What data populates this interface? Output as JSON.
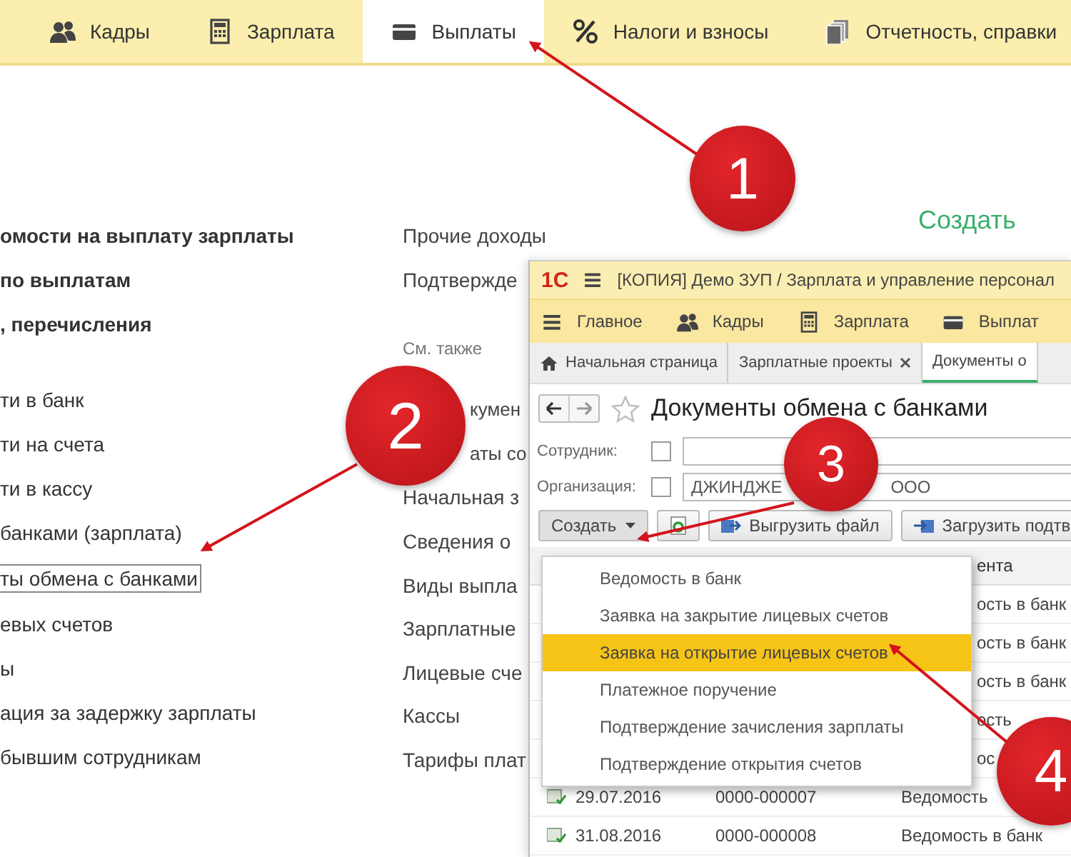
{
  "top_menu": [
    {
      "kind": "people",
      "label": "Кадры",
      "selected": false
    },
    {
      "kind": "calculator",
      "label": "Зарплата",
      "selected": false
    },
    {
      "kind": "card",
      "label": "Выплаты",
      "selected": true
    },
    {
      "kind": "percent",
      "label": "Налоги и взносы",
      "selected": false
    },
    {
      "kind": "documents",
      "label": "Отчетность, справки",
      "selected": false
    }
  ],
  "left_column": [
    {
      "text": "омости на выплату зарплаты",
      "kind": "heading",
      "focused": false
    },
    {
      "text": "по выплатам",
      "kind": "heading",
      "focused": false
    },
    {
      "text": ", перечисления",
      "kind": "heading",
      "focused": false
    },
    {
      "text": "ти в банк",
      "kind": "link",
      "focused": false
    },
    {
      "text": "ти на счета",
      "kind": "link",
      "focused": false
    },
    {
      "text": "ти в кассу",
      "kind": "link",
      "focused": false
    },
    {
      "text": "банками (зарплата)",
      "kind": "link",
      "focused": false
    },
    {
      "text": "ты обмена с банками",
      "kind": "link",
      "focused": true
    },
    {
      "text": "евых счетов",
      "kind": "link",
      "focused": false
    },
    {
      "text": "ы",
      "kind": "link",
      "focused": false
    },
    {
      "text": "ация за задержку зарплаты",
      "kind": "link",
      "focused": false
    },
    {
      "text": "бывшим сотрудникам",
      "kind": "link",
      "focused": false
    }
  ],
  "middle_column": [
    {
      "text": "Прочие доходы",
      "kind": "link"
    },
    {
      "text": "Подтвержде",
      "kind": "link"
    },
    {
      "text": "См. также",
      "kind": "heading"
    },
    {
      "text": "кумен",
      "kind": "covered"
    },
    {
      "text": "аты со",
      "kind": "covered"
    },
    {
      "text": "Начальная з",
      "kind": "link"
    },
    {
      "text": "Сведения о",
      "kind": "link"
    },
    {
      "text": "Виды выпла",
      "kind": "link"
    },
    {
      "text": "Зарплатные",
      "kind": "link"
    },
    {
      "text": "Лицевые сче",
      "kind": "link"
    },
    {
      "text": "Кассы",
      "kind": "link"
    },
    {
      "text": "Тарифы плат",
      "kind": "link"
    }
  ],
  "create_link": "Создать",
  "window": {
    "logo": "1С",
    "title": "[КОПИЯ] Демо ЗУП / Зарплата и управление персонал",
    "sections": [
      {
        "kind": "menu",
        "label": "Главное"
      },
      {
        "kind": "people",
        "label": "Кадры"
      },
      {
        "kind": "calculator",
        "label": "Зарплата"
      },
      {
        "kind": "card",
        "label": "Выплат"
      }
    ],
    "tabs": [
      {
        "kind": "home",
        "label": "Начальная страница",
        "selected": false
      },
      {
        "kind": "closable",
        "label": "Зарплатные проекты",
        "selected": false
      },
      {
        "kind": "plain",
        "label": "Документы о",
        "selected": true
      }
    ],
    "heading": "Документы обмена с банками",
    "filters": [
      {
        "label": "Сотрудник:",
        "checked": false
      },
      {
        "label": "Организация:",
        "checked": false,
        "value_parts": [
          "ДЖИНДЖЕ",
          "ООО"
        ]
      }
    ],
    "toolbar": [
      {
        "kind": "dropdown",
        "label": "Создать"
      },
      {
        "kind": "refresh"
      },
      {
        "kind": "export",
        "label": "Выгрузить файл"
      },
      {
        "kind": "import",
        "label": "Загрузить подтв"
      }
    ],
    "table": {
      "header": "ента",
      "rows": [
        {
          "type": "ость в банк"
        },
        {
          "type": "ость в банк"
        },
        {
          "type": "ость в банк"
        },
        {
          "type": "ость"
        },
        {
          "type": "ос"
        },
        {
          "date": "29.07.2016",
          "number": "0000-000007",
          "type": "Ведомость"
        },
        {
          "date": "31.08.2016",
          "number": "0000-000008",
          "type": "Ведомость в банк"
        }
      ]
    },
    "create_menu": [
      {
        "label": "Ведомость в банк",
        "selected": false
      },
      {
        "label": "Заявка на закрытие лицевых счетов",
        "selected": false
      },
      {
        "label": "Заявка на открытие лицевых счетов",
        "selected": true
      },
      {
        "label": "Платежное поручение",
        "selected": false
      },
      {
        "label": "Подтверждение зачисления зарплаты",
        "selected": false
      },
      {
        "label": "Подтверждение открытия счетов",
        "selected": false
      }
    ]
  },
  "callouts": [
    "1",
    "2",
    "3",
    "4"
  ]
}
